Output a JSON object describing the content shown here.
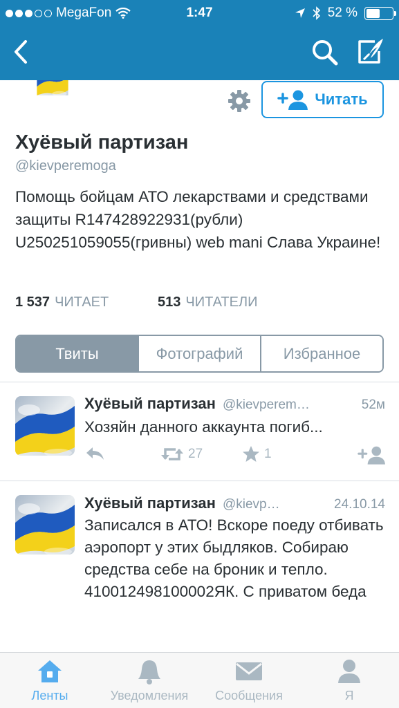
{
  "status_bar": {
    "carrier": "MegaFon",
    "time": "1:47",
    "battery": "52 %",
    "battery_level": 0.52
  },
  "profile": {
    "name": "Хуёвый партизан",
    "handle": "@kievperemoga",
    "bio": "Помощь бойцам АТО лекарствами и средствами защиты R147428922931(рубли) U250251059055(гривны) web mani Слава Украине!",
    "follow_label": "Читать",
    "following_count": "1 537",
    "following_label": "ЧИТАЕТ",
    "followers_count": "513",
    "followers_label": "ЧИТАТЕЛИ"
  },
  "segments": {
    "tweets": "Твиты",
    "photos": "Фотографий",
    "favorites": "Избранное",
    "active": "tweets"
  },
  "tweets": [
    {
      "name": "Хуёвый партизан",
      "handle": "@kievperem…",
      "time": "52м",
      "text": "Хозяйн данного аккаунта погиб...",
      "retweets": "27",
      "favorites": "1"
    },
    {
      "name": "Хуёвый партизан",
      "handle": "@kievp…",
      "time": "24.10.14",
      "text": "Записался в АТО! Вскоре поеду отбивать аэропорт у этих быдляков. Собираю средства себе на броник и тепло. 410012498100002ЯК. С приватом беда"
    }
  ],
  "tabbar": {
    "items": [
      {
        "label": "Ленты",
        "icon": "home-icon",
        "active": true
      },
      {
        "label": "Уведомления",
        "icon": "bell-icon",
        "active": false
      },
      {
        "label": "Сообщения",
        "icon": "envelope-icon",
        "active": false
      },
      {
        "label": "Я",
        "icon": "person-icon",
        "active": false
      }
    ]
  },
  "colors": {
    "nav_bar": "#1a82b8",
    "accent": "#1b95e0",
    "muted": "#8899a6",
    "tab_active": "#55acee"
  }
}
